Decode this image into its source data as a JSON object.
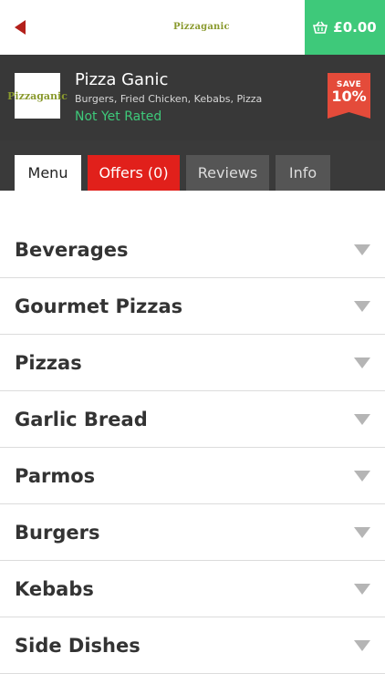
{
  "header": {
    "logo_text": "Pizzaganic",
    "cart_total": "£0.00"
  },
  "restaurant": {
    "logo_text": "Pizzaganic",
    "name": "Pizza Ganic",
    "cuisines": "Burgers, Fried Chicken, Kebabs, Pizza",
    "rating": "Not Yet Rated",
    "save_label": "SAVE",
    "save_value": "10%"
  },
  "tabs": [
    {
      "label": "Menu"
    },
    {
      "label": "Offers (0)"
    },
    {
      "label": "Reviews"
    },
    {
      "label": "Info"
    }
  ],
  "menu": [
    {
      "label": "Beverages"
    },
    {
      "label": "Gourmet Pizzas"
    },
    {
      "label": "Pizzas"
    },
    {
      "label": "Garlic Bread"
    },
    {
      "label": "Parmos"
    },
    {
      "label": "Burgers"
    },
    {
      "label": "Kebabs"
    },
    {
      "label": "Side Dishes"
    }
  ],
  "colors": {
    "accent_green": "#3ec97a",
    "accent_red": "#e1201b",
    "dark_header": "#383838"
  }
}
